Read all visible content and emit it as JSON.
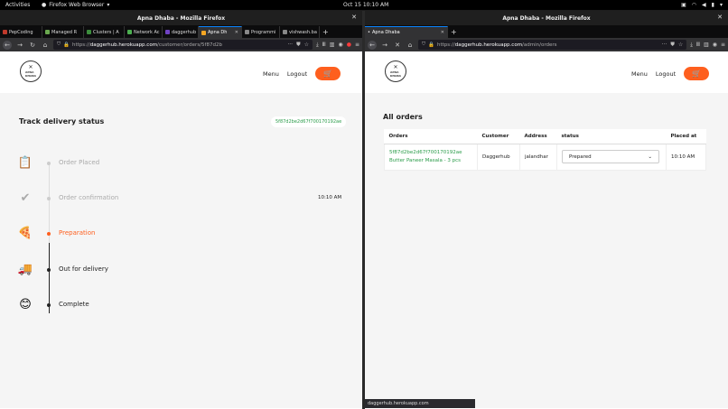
{
  "system": {
    "activities": "Activities",
    "app_name": "Firefox Web Browser",
    "clock": "Oct 15  10:10 AM"
  },
  "left_window": {
    "title": "Apna Dhaba - Mozilla Firefox",
    "tabs": [
      {
        "label": "PepCoding",
        "color": "#c0392b",
        "active": false
      },
      {
        "label": "Managed R",
        "color": "#6aa84f",
        "active": false
      },
      {
        "label": "Clusters | A",
        "color": "#3c8d3c",
        "active": false
      },
      {
        "label": "Network Ac",
        "color": "#4caf50",
        "active": false
      },
      {
        "label": "daggerhub",
        "color": "#6f42c1",
        "active": false
      },
      {
        "label": "Apna Dh",
        "color": "#f5a623",
        "active": true
      },
      {
        "label": "Programmi",
        "color": "#888888",
        "active": false
      },
      {
        "label": "vishwash.ba",
        "color": "#888888",
        "active": false
      }
    ],
    "url_prefix": "https://",
    "url_host": "daggerhub.herokuapp.com",
    "url_path": "/customer/orders/5f87d2b",
    "nav": {
      "menu": "Menu",
      "logout": "Logout"
    },
    "track_title": "Track delivery status",
    "order_id": "5f87d2be2d67f700170192ae",
    "steps": [
      {
        "label": "Order Placed",
        "state": "done",
        "icon": "📋"
      },
      {
        "label": "Order confirmation",
        "state": "done",
        "icon": "✔",
        "time": "10:10 AM"
      },
      {
        "label": "Preparation",
        "state": "current",
        "icon": "🍕"
      },
      {
        "label": "Out for delivery",
        "state": "pending",
        "icon": "🚚"
      },
      {
        "label": "Complete",
        "state": "pending",
        "icon": "😊"
      }
    ]
  },
  "right_window": {
    "title": "Apna Dhaba - Mozilla Firefox",
    "tab_label": "Apna Dhaba",
    "url_prefix": "https://",
    "url_host": "daggerhub.herokuapp.com",
    "url_path": "/admin/orders",
    "nav": {
      "menu": "Menu",
      "logout": "Logout"
    },
    "orders_title": "All orders",
    "columns": [
      "Orders",
      "Customer",
      "Address",
      "status",
      "Placed at"
    ],
    "rows": [
      {
        "order_id": "5f87d2be2d67f700170192ae",
        "items": "Butter Paneer Masala - 3 pcs",
        "customer": "Daggerhub",
        "address": "jalandhar",
        "status": "Prepared",
        "placed_at": "10:10 AM"
      }
    ],
    "status_url": "daggerhub.herokuapp.com"
  },
  "colors": {
    "accent": "#fe5f1e",
    "id_green": "#2b9c4a"
  }
}
